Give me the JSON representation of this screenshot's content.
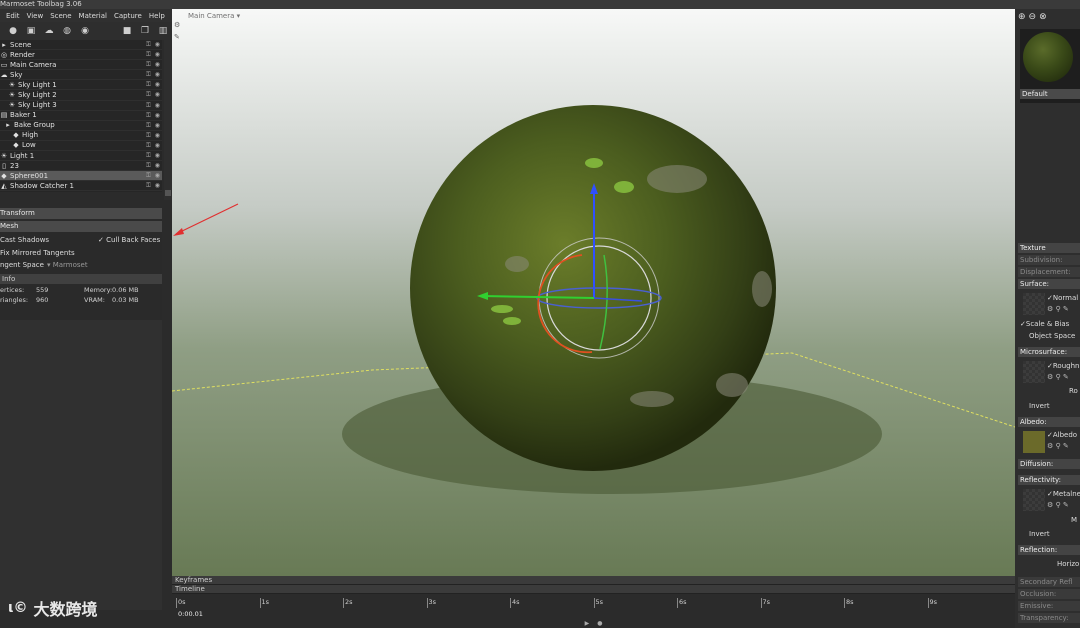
{
  "app": {
    "title": "Marmoset Toolbag 3.06"
  },
  "menu": [
    "Edit",
    "View",
    "Scene",
    "Material",
    "Capture",
    "Help"
  ],
  "toolbar_icons": [
    "light-icon",
    "screen-icon",
    "sky-icon",
    "camera-icon",
    "sphere-icon",
    "folder-icon",
    "duplicate-icon",
    "trash-icon"
  ],
  "scene_tree": [
    {
      "label": "Scene",
      "icon": "folder-icon"
    },
    {
      "label": "Render",
      "icon": "render-icon"
    },
    {
      "label": "Main Camera",
      "icon": "camera-icon"
    },
    {
      "label": "Sky",
      "icon": "sky-icon"
    },
    {
      "label": "Sky Light 1",
      "icon": "light-icon"
    },
    {
      "label": "Sky Light 2",
      "icon": "light-icon"
    },
    {
      "label": "Sky Light 3",
      "icon": "light-icon"
    },
    {
      "label": "Baker 1",
      "icon": "baker-icon"
    },
    {
      "label": "Bake Group",
      "icon": "folder-icon"
    },
    {
      "label": "High",
      "icon": "mesh-icon"
    },
    {
      "label": "Low",
      "icon": "mesh-icon"
    },
    {
      "label": "Light 1",
      "icon": "light-icon"
    },
    {
      "label": "23",
      "icon": "document-icon"
    },
    {
      "label": "Sphere001",
      "icon": "mesh-icon",
      "selected": true
    },
    {
      "label": "Shadow Catcher 1",
      "icon": "shadow-icon"
    }
  ],
  "props": {
    "transform": "Transform",
    "mesh": "Mesh",
    "cast_shadows": "Cast Shadows",
    "cull_back_faces": "Cull Back Faces",
    "fix_mirrored": "Fix Mirrored Tangents",
    "tangent_space_label": "ngent Space",
    "tangent_space_value": "Marmoset",
    "info": "Info",
    "vertices_label": "ertices:",
    "vertices_value": "559",
    "triangles_label": "riangles:",
    "triangles_value": "960",
    "memory_label": "Memory:",
    "memory_value": "0.06 MB",
    "vram_label": "VRAM:",
    "vram_value": "0.03 MB"
  },
  "viewport": {
    "camera_label": "Main Camera ▾"
  },
  "timeline": {
    "keyframes": "Keyframes",
    "timeline": "Timeline",
    "ticks": [
      "0s",
      "1s",
      "2s",
      "3s",
      "4s",
      "5s",
      "6s",
      "7s",
      "8s",
      "9s"
    ],
    "time": "0:00.01"
  },
  "material": {
    "name": "Default",
    "texture": "Texture",
    "subdivision": "Subdivision:",
    "displacement": "Displacement:",
    "surface": "Surface:",
    "normal": "Normal",
    "scale_bias": "Scale & Bias",
    "object_space": "Object Space",
    "microsurface": "Microsurface:",
    "roughness": "Roughn",
    "ro": "Ro",
    "invert": "Invert",
    "albedo_head": "Albedo:",
    "albedo": "Albedo",
    "diffusion": "Diffusion:",
    "reflectivity": "Reflectivity:",
    "metalness": "Metalne",
    "m": "M",
    "invert2": "Invert",
    "reflection": "Reflection:",
    "horizon": "Horizo",
    "secondary": "Secondary Refl",
    "occlusion": "Occlusion:",
    "emissive": "Emissive:",
    "transparency": "Transparency:"
  },
  "watermark": "大数跨境"
}
